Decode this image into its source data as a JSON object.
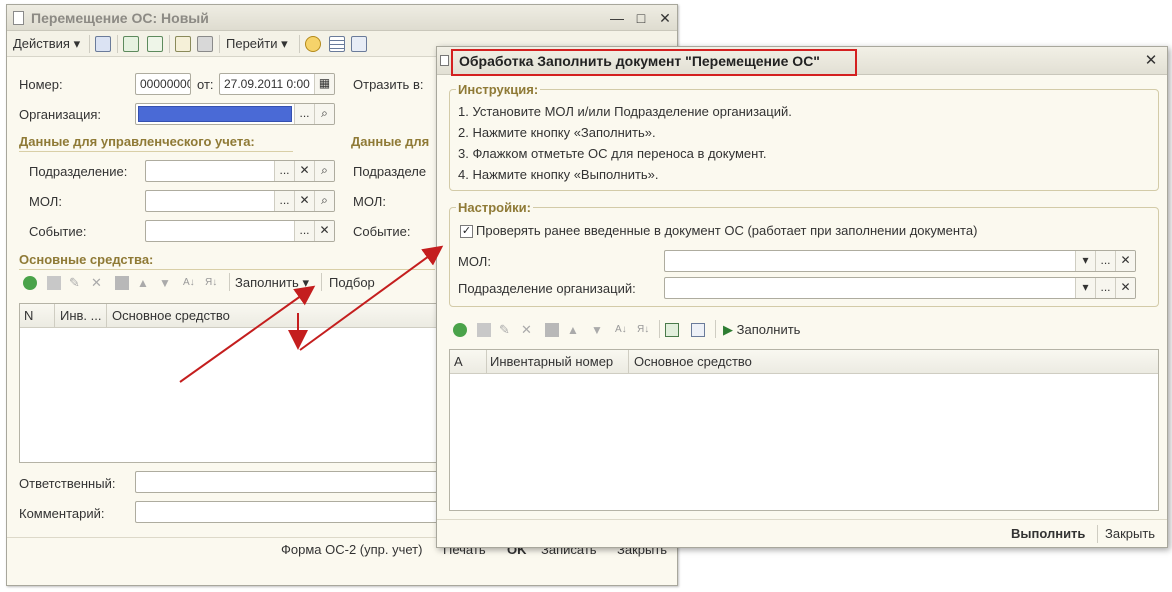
{
  "main_window": {
    "title": "Перемещение ОС: Новый",
    "controls": {
      "minimize": "—",
      "maximize": "□",
      "close": "✕"
    },
    "toolbar": {
      "actions_label": "Действия",
      "goto_label": "Перейти",
      "icons": [
        "post-icon",
        "refresh-icon",
        "copy-icon",
        "document-add-icon",
        "print-icon",
        "help-icon",
        "list-icon",
        "structure-icon"
      ]
    },
    "form": {
      "number_label": "Номер:",
      "number_value": "00000000",
      "date_label": "от:",
      "date_value": "27.09.2011 0:00",
      "reflect_label": "Отразить в:",
      "org_label": "Организация:",
      "org_value": "",
      "mgmt_section": "Данные для управленческого учета:",
      "mgmt_section_right": "Данные для",
      "subdivision_label": "Подразделение:",
      "subdivision_label_right": "Подразделе",
      "mol_label": "МОЛ:",
      "mol_label_right": "МОЛ:",
      "event_label": "Событие:",
      "event_label_right": "Событие:",
      "assets_section": "Основные средства:",
      "fill_button": "Заполнить",
      "pick_button": "Подбор",
      "columns": [
        "N",
        "Инв. ...",
        "Основное средство"
      ],
      "responsible_label": "Ответственный:",
      "comment_label": "Комментарий:"
    },
    "footer": {
      "form_name": "Форма ОС-2 (упр. учет)",
      "print": "Печать",
      "ok": "OK",
      "save": "Записать",
      "close": "Закрыть"
    }
  },
  "dialog": {
    "title": "Обработка  Заполнить документ \"Перемещение ОС\"",
    "close": "✕",
    "instructions": {
      "header": "Инструкция:",
      "items": [
        "1. Установите МОЛ и/или Подразделение организаций.",
        "2. Нажмите кнопку «Заполнить».",
        "3. Флажком отметьте ОС для переноса в документ.",
        "4. Нажмите кнопку «Выполнить»."
      ]
    },
    "settings": {
      "header": "Настройки:",
      "check_label": "Проверять ранее введенные в документ ОС (работает при заполнении документа)",
      "checked": true,
      "mol_label": "МОЛ:",
      "mol_value": "",
      "subdivision_label": "Подразделение организаций:",
      "subdivision_value": ""
    },
    "toolbar": {
      "fill_label": "Заполнить",
      "icons": [
        "add-icon",
        "copy-icon",
        "edit-icon",
        "delete-icon",
        "save-icon",
        "move-up-icon",
        "move-down-icon",
        "sort-asc-icon",
        "sort-desc-icon",
        "check-all-icon",
        "uncheck-all-icon",
        "play-icon"
      ]
    },
    "columns": [
      "А",
      "Инвентарный номер",
      "Основное средство"
    ],
    "footer": {
      "execute": "Выполнить",
      "close": "Закрыть"
    }
  },
  "colors": {
    "highlight_box": "#d42020",
    "arrows": "#c41e1e",
    "section_header": "#8f7a36",
    "selected_field": "#4a6ad6"
  }
}
